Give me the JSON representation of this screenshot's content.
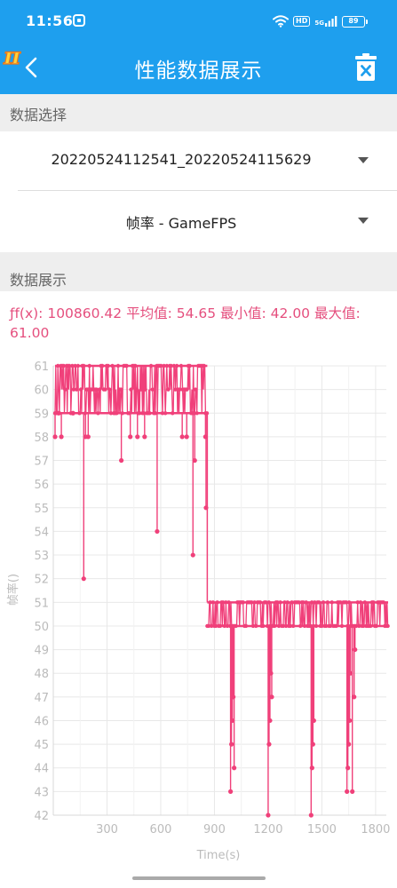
{
  "status_bar": {
    "time": "11:56",
    "network_badge": "HD",
    "network_type": "5G",
    "battery": "89",
    "icons": [
      "wifi-icon",
      "hd-icon",
      "signal-icon",
      "battery-icon"
    ]
  },
  "app_bar": {
    "title": "性能数据展示",
    "logo_text": "π",
    "background": "#1e9fee"
  },
  "data_select": {
    "header": "数据选择",
    "file_value": "20220524112541_20220524115629",
    "metric_value": "帧率 - GameFPS"
  },
  "data_display": {
    "header": "数据展示",
    "stats": "ƒf(x): 100860.42 平均值: 54.65 最小值: 42.00 最大值: 61.00",
    "accent": "#e54f7e"
  },
  "chart_data": {
    "type": "line",
    "xlabel": "Time(s)",
    "ylabel": "帧率()",
    "xlim": [
      0,
      1860
    ],
    "ylim": [
      42,
      61
    ],
    "x_ticks": [
      300,
      600,
      900,
      1200,
      1500,
      1800
    ],
    "y_ticks": [
      42,
      43,
      44,
      45,
      46,
      47,
      48,
      49,
      50,
      51,
      52,
      53,
      54,
      55,
      56,
      57,
      58,
      59,
      60,
      61
    ],
    "grid": true,
    "color": "#f0407a",
    "series": [
      {
        "segments": [
          {
            "x_start": 10,
            "x_end": 860,
            "low": 59,
            "high": 61,
            "mid": 60,
            "mean": 60
          },
          {
            "x_start": 860,
            "x_end": 1870,
            "low": 50,
            "high": 51,
            "mean": 50.5
          }
        ],
        "spikes": [
          {
            "x": 10,
            "y": 58
          },
          {
            "x": 30,
            "y": 59
          },
          {
            "x": 45,
            "y": 58
          },
          {
            "x": 110,
            "y": 59
          },
          {
            "x": 170,
            "y": 52
          },
          {
            "x": 180,
            "y": 58
          },
          {
            "x": 195,
            "y": 58
          },
          {
            "x": 380,
            "y": 57
          },
          {
            "x": 430,
            "y": 58
          },
          {
            "x": 470,
            "y": 58
          },
          {
            "x": 510,
            "y": 58
          },
          {
            "x": 580,
            "y": 54
          },
          {
            "x": 720,
            "y": 58
          },
          {
            "x": 745,
            "y": 58
          },
          {
            "x": 780,
            "y": 53
          },
          {
            "x": 790,
            "y": 57
          },
          {
            "x": 850,
            "y": 58
          },
          {
            "x": 853,
            "y": 55
          },
          {
            "x": 990,
            "y": 43
          },
          {
            "x": 995,
            "y": 45
          },
          {
            "x": 1000,
            "y": 46
          },
          {
            "x": 1005,
            "y": 47
          },
          {
            "x": 1010,
            "y": 44
          },
          {
            "x": 1200,
            "y": 42
          },
          {
            "x": 1205,
            "y": 45
          },
          {
            "x": 1210,
            "y": 46
          },
          {
            "x": 1215,
            "y": 48
          },
          {
            "x": 1220,
            "y": 47
          },
          {
            "x": 1440,
            "y": 42
          },
          {
            "x": 1445,
            "y": 44
          },
          {
            "x": 1450,
            "y": 45
          },
          {
            "x": 1455,
            "y": 46
          },
          {
            "x": 1640,
            "y": 43
          },
          {
            "x": 1645,
            "y": 44
          },
          {
            "x": 1650,
            "y": 45
          },
          {
            "x": 1655,
            "y": 46
          },
          {
            "x": 1660,
            "y": 48
          },
          {
            "x": 1670,
            "y": 43
          },
          {
            "x": 1680,
            "y": 47
          },
          {
            "x": 1685,
            "y": 49
          }
        ]
      }
    ]
  }
}
